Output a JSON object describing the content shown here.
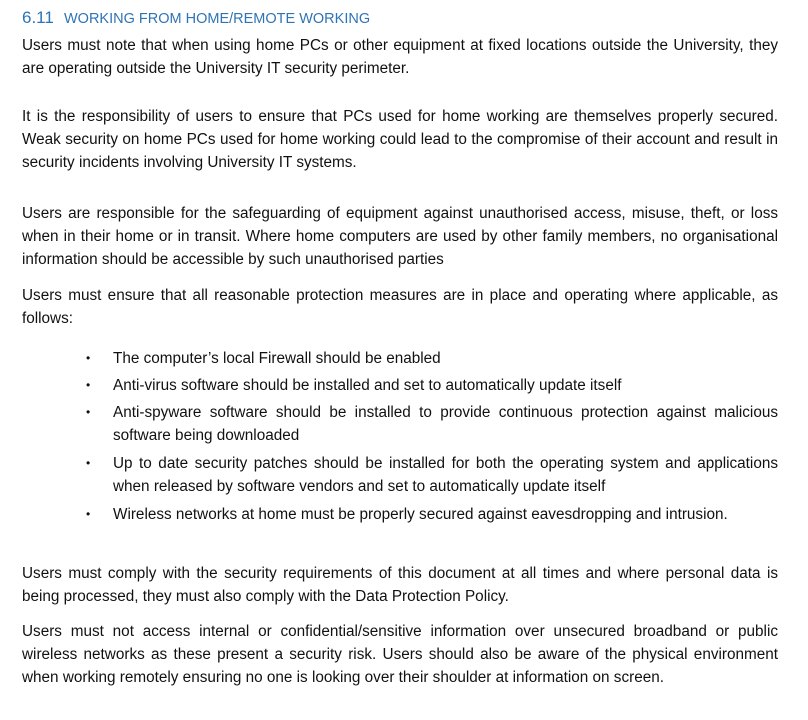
{
  "heading": {
    "number": "6.11",
    "title": "WORKING FROM HOME/REMOTE WORKING"
  },
  "paragraphs": [
    "Users must note that when using home PCs or other equipment at fixed locations outside the University, they are operating outside the University IT security perimeter.",
    "It is the responsibility of users to ensure that PCs used for home working are themselves properly secured.  Weak security on home PCs used for home working could lead to the compromise of their account and result in security incidents involving University IT systems.",
    "Users are responsible for the safeguarding of equipment against unauthorised access, misuse, theft, or loss when in their home or in transit.  Where home computers are used by other family members, no organisational information should be accessible by such unauthorised parties",
    "Users must ensure that all reasonable protection measures are in place and operating where applicable, as follows:",
    "Users must comply with the security requirements of this document at all times and where personal data is being processed, they must also comply with the Data Protection Policy.",
    "Users must not access internal or confidential/sensitive information over unsecured broadband or public wireless networks as these present a security risk.  Users should also be aware of the physical environment when working remotely ensuring no one is looking over their shoulder at information on screen."
  ],
  "bullet_glyph": "•",
  "bullets": [
    "The computer’s local Firewall should be enabled",
    "Anti-virus software should be installed and set to automatically update itself",
    "Anti-spyware software should be installed to provide continuous protection against malicious software being downloaded",
    "Up to date security patches should be installed for both the operating system and applications when released by software vendors and set to automatically update itself",
    "Wireless networks at home must be properly secured against eavesdropping and intrusion."
  ]
}
